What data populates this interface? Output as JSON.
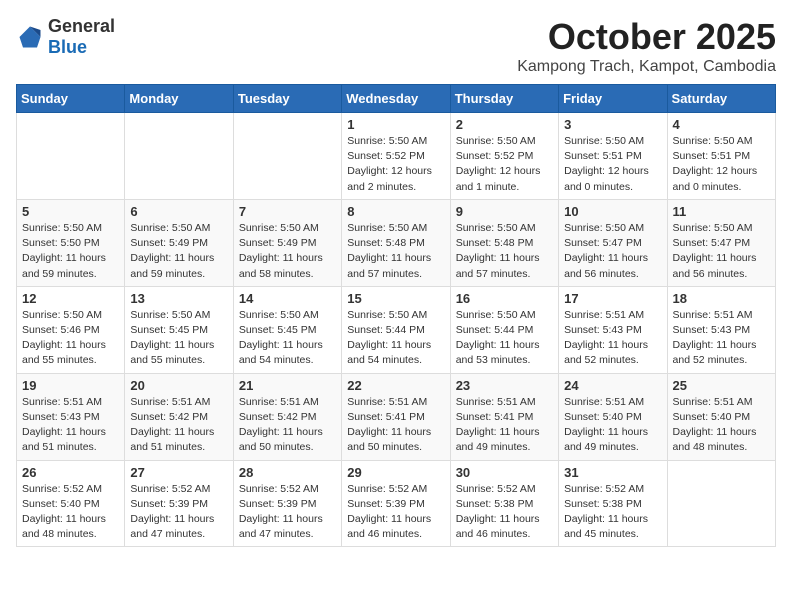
{
  "header": {
    "logo_general": "General",
    "logo_blue": "Blue",
    "month": "October 2025",
    "location": "Kampong Trach, Kampot, Cambodia"
  },
  "weekdays": [
    "Sunday",
    "Monday",
    "Tuesday",
    "Wednesday",
    "Thursday",
    "Friday",
    "Saturday"
  ],
  "weeks": [
    [
      {
        "day": "",
        "info": ""
      },
      {
        "day": "",
        "info": ""
      },
      {
        "day": "",
        "info": ""
      },
      {
        "day": "1",
        "info": "Sunrise: 5:50 AM\nSunset: 5:52 PM\nDaylight: 12 hours\nand 2 minutes."
      },
      {
        "day": "2",
        "info": "Sunrise: 5:50 AM\nSunset: 5:52 PM\nDaylight: 12 hours\nand 1 minute."
      },
      {
        "day": "3",
        "info": "Sunrise: 5:50 AM\nSunset: 5:51 PM\nDaylight: 12 hours\nand 0 minutes."
      },
      {
        "day": "4",
        "info": "Sunrise: 5:50 AM\nSunset: 5:51 PM\nDaylight: 12 hours\nand 0 minutes."
      }
    ],
    [
      {
        "day": "5",
        "info": "Sunrise: 5:50 AM\nSunset: 5:50 PM\nDaylight: 11 hours\nand 59 minutes."
      },
      {
        "day": "6",
        "info": "Sunrise: 5:50 AM\nSunset: 5:49 PM\nDaylight: 11 hours\nand 59 minutes."
      },
      {
        "day": "7",
        "info": "Sunrise: 5:50 AM\nSunset: 5:49 PM\nDaylight: 11 hours\nand 58 minutes."
      },
      {
        "day": "8",
        "info": "Sunrise: 5:50 AM\nSunset: 5:48 PM\nDaylight: 11 hours\nand 57 minutes."
      },
      {
        "day": "9",
        "info": "Sunrise: 5:50 AM\nSunset: 5:48 PM\nDaylight: 11 hours\nand 57 minutes."
      },
      {
        "day": "10",
        "info": "Sunrise: 5:50 AM\nSunset: 5:47 PM\nDaylight: 11 hours\nand 56 minutes."
      },
      {
        "day": "11",
        "info": "Sunrise: 5:50 AM\nSunset: 5:47 PM\nDaylight: 11 hours\nand 56 minutes."
      }
    ],
    [
      {
        "day": "12",
        "info": "Sunrise: 5:50 AM\nSunset: 5:46 PM\nDaylight: 11 hours\nand 55 minutes."
      },
      {
        "day": "13",
        "info": "Sunrise: 5:50 AM\nSunset: 5:45 PM\nDaylight: 11 hours\nand 55 minutes."
      },
      {
        "day": "14",
        "info": "Sunrise: 5:50 AM\nSunset: 5:45 PM\nDaylight: 11 hours\nand 54 minutes."
      },
      {
        "day": "15",
        "info": "Sunrise: 5:50 AM\nSunset: 5:44 PM\nDaylight: 11 hours\nand 54 minutes."
      },
      {
        "day": "16",
        "info": "Sunrise: 5:50 AM\nSunset: 5:44 PM\nDaylight: 11 hours\nand 53 minutes."
      },
      {
        "day": "17",
        "info": "Sunrise: 5:51 AM\nSunset: 5:43 PM\nDaylight: 11 hours\nand 52 minutes."
      },
      {
        "day": "18",
        "info": "Sunrise: 5:51 AM\nSunset: 5:43 PM\nDaylight: 11 hours\nand 52 minutes."
      }
    ],
    [
      {
        "day": "19",
        "info": "Sunrise: 5:51 AM\nSunset: 5:43 PM\nDaylight: 11 hours\nand 51 minutes."
      },
      {
        "day": "20",
        "info": "Sunrise: 5:51 AM\nSunset: 5:42 PM\nDaylight: 11 hours\nand 51 minutes."
      },
      {
        "day": "21",
        "info": "Sunrise: 5:51 AM\nSunset: 5:42 PM\nDaylight: 11 hours\nand 50 minutes."
      },
      {
        "day": "22",
        "info": "Sunrise: 5:51 AM\nSunset: 5:41 PM\nDaylight: 11 hours\nand 50 minutes."
      },
      {
        "day": "23",
        "info": "Sunrise: 5:51 AM\nSunset: 5:41 PM\nDaylight: 11 hours\nand 49 minutes."
      },
      {
        "day": "24",
        "info": "Sunrise: 5:51 AM\nSunset: 5:40 PM\nDaylight: 11 hours\nand 49 minutes."
      },
      {
        "day": "25",
        "info": "Sunrise: 5:51 AM\nSunset: 5:40 PM\nDaylight: 11 hours\nand 48 minutes."
      }
    ],
    [
      {
        "day": "26",
        "info": "Sunrise: 5:52 AM\nSunset: 5:40 PM\nDaylight: 11 hours\nand 48 minutes."
      },
      {
        "day": "27",
        "info": "Sunrise: 5:52 AM\nSunset: 5:39 PM\nDaylight: 11 hours\nand 47 minutes."
      },
      {
        "day": "28",
        "info": "Sunrise: 5:52 AM\nSunset: 5:39 PM\nDaylight: 11 hours\nand 47 minutes."
      },
      {
        "day": "29",
        "info": "Sunrise: 5:52 AM\nSunset: 5:39 PM\nDaylight: 11 hours\nand 46 minutes."
      },
      {
        "day": "30",
        "info": "Sunrise: 5:52 AM\nSunset: 5:38 PM\nDaylight: 11 hours\nand 46 minutes."
      },
      {
        "day": "31",
        "info": "Sunrise: 5:52 AM\nSunset: 5:38 PM\nDaylight: 11 hours\nand 45 minutes."
      },
      {
        "day": "",
        "info": ""
      }
    ]
  ]
}
